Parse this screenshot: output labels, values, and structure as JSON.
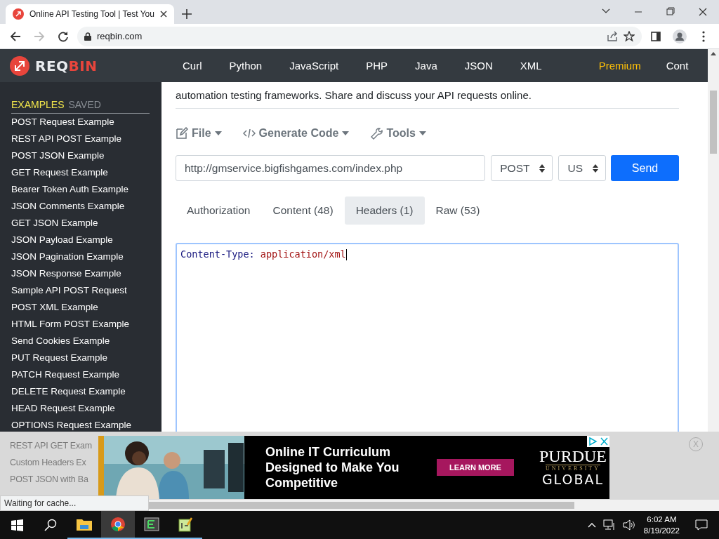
{
  "browser": {
    "tabs": [
      {
        "title": "Online API Testing Tool | Test You",
        "selected": true
      }
    ],
    "url": "reqbin.com"
  },
  "nav": {
    "logo_first": "REQ",
    "logo_second": "BIN",
    "links": [
      {
        "label": "Curl",
        "kind": "link"
      },
      {
        "label": "Python",
        "kind": "link"
      },
      {
        "label": "JavaScript",
        "kind": "link"
      },
      {
        "label": "PHP",
        "kind": "link"
      },
      {
        "label": "Java",
        "kind": "link"
      },
      {
        "label": "JSON",
        "kind": "link"
      },
      {
        "label": "XML",
        "kind": "link"
      },
      {
        "label": "Premium",
        "kind": "premium"
      },
      {
        "label": "Cont",
        "kind": "link"
      }
    ]
  },
  "sidebar": {
    "tabs": [
      {
        "label": "EXAMPLES",
        "selected": true
      },
      {
        "label": "SAVED",
        "selected": false
      }
    ],
    "items": [
      "POST Request Example",
      "REST API POST Example",
      "POST JSON Example",
      "GET Request Example",
      "Bearer Token Auth Example",
      "JSON Comments Example",
      "GET JSON Example",
      "JSON Payload Example",
      "JSON Pagination Example",
      "JSON Response Example",
      "Sample API POST Request",
      "POST XML Example",
      "HTML Form POST Example",
      "Send Cookies Example",
      "PUT Request Example",
      "PATCH Request Example",
      "DELETE Request Example",
      "HEAD Request Example",
      "OPTIONS Request Example"
    ],
    "covered_items": [
      "REST API GET Exam",
      "Custom Headers Ex",
      "POST JSON with Ba"
    ]
  },
  "intro": "automation testing frameworks. Share and discuss your API requests online.",
  "toolbar": [
    {
      "label": "File",
      "kind": "file"
    },
    {
      "label": "Generate Code",
      "kind": "code"
    },
    {
      "label": "Tools",
      "kind": "tools"
    }
  ],
  "request": {
    "url": "http://gmservice.bigfishgames.com/index.php",
    "method": "POST",
    "region": "US",
    "send": "Send"
  },
  "tabs": [
    {
      "label": "Authorization",
      "selected": false
    },
    {
      "label": "Content (48)",
      "selected": false
    },
    {
      "label": "Headers (1)",
      "selected": true
    },
    {
      "label": "Raw (53)",
      "selected": false
    }
  ],
  "editor": {
    "header_name": "Content-Type:",
    "header_value": "application/xml"
  },
  "ad": {
    "headline": "Online IT Curriculum Designed to Make You Competitive",
    "cta": "LEARN MORE",
    "logo_name": "PURDUE",
    "logo_sub": "UNIVERSITY",
    "logo_line": "GLOBAL",
    "close": "X"
  },
  "status_bar": "Waiting for cache...",
  "taskbar": {
    "apps": [
      {
        "kind": "explorer",
        "selected": false
      },
      {
        "kind": "chrome",
        "selected": true
      },
      {
        "kind": "terminal",
        "selected": false
      },
      {
        "kind": "notepad",
        "selected": false
      }
    ],
    "time": "6:02 AM",
    "date": "8/19/2022"
  }
}
